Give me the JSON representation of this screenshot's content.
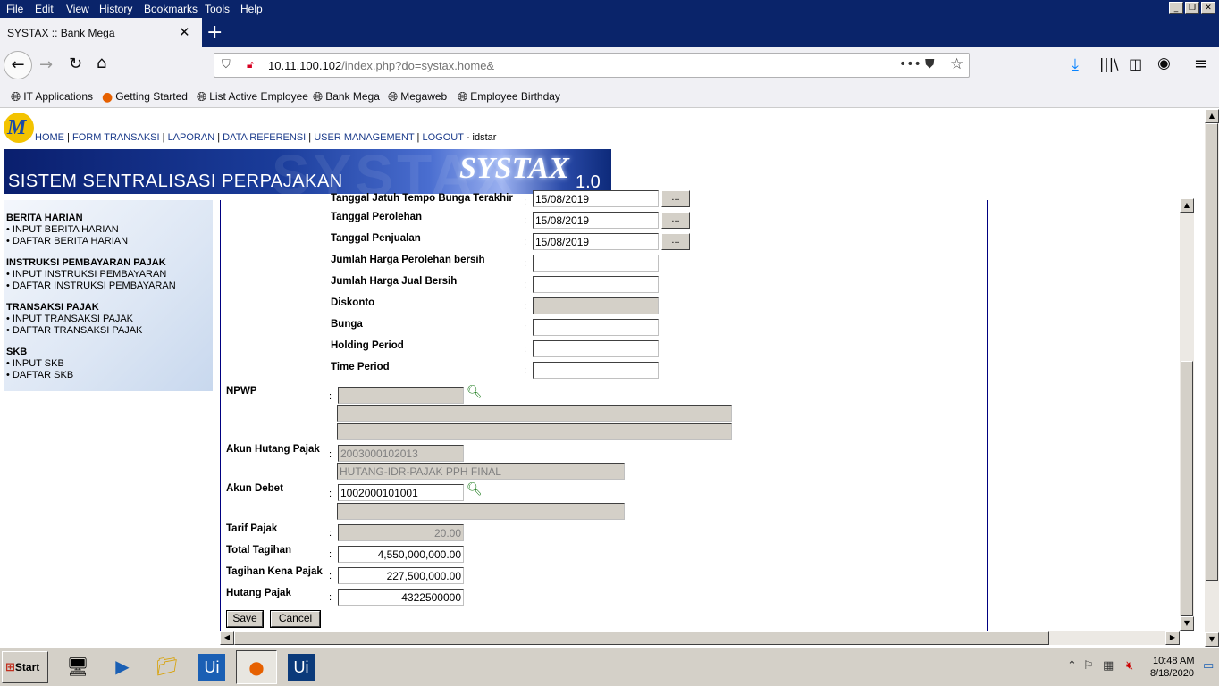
{
  "menubar": {
    "items": [
      "File",
      "Edit",
      "View",
      "History",
      "Bookmarks",
      "Tools",
      "Help"
    ]
  },
  "browser": {
    "tab_title": "SYSTAX :: Bank Mega",
    "url_host": "10.11.100.102",
    "url_path": "/index.php?do=systax.home&",
    "icons": {
      "back": "back-arrow-icon",
      "forward": "forward-arrow-icon",
      "reload": "reload-icon",
      "home": "home-icon",
      "download": "download-icon",
      "library": "library-icon",
      "sidebar": "sidebar-icon",
      "account": "account-icon",
      "menu": "hamburger-menu-icon"
    }
  },
  "bookmarks": [
    "IT Applications",
    "Getting Started",
    "List Active Employee",
    "Bank Mega",
    "Megaweb",
    "Employee Birthday"
  ],
  "site": {
    "topnav": [
      "HOME",
      "FORM TRANSAKSI",
      "LAPORAN",
      "DATA REFERENSI",
      "USER MANAGEMENT",
      "LOGOUT"
    ],
    "user_suffix": "- idstar",
    "banner_title": "SISTEM SENTRALISASI PERPAJAKAN",
    "banner_logo": "SYSTAX",
    "banner_version": "1.0",
    "banner_bg_text": "SYSTAX",
    "logo_letter": "M"
  },
  "sidebar": {
    "sections": [
      {
        "title": "BERITA HARIAN",
        "items": [
          "• INPUT BERITA HARIAN",
          "• DAFTAR BERITA HARIAN"
        ]
      },
      {
        "title": "INSTRUKSI PEMBAYARAN PAJAK",
        "items": [
          "• INPUT INSTRUKSI PEMBAYARAN",
          "• DAFTAR INSTRUKSI PEMBAYARAN"
        ]
      },
      {
        "title": "TRANSAKSI PAJAK",
        "items": [
          "• INPUT TRANSAKSI PAJAK",
          "• DAFTAR TRANSAKSI PAJAK"
        ]
      },
      {
        "title": "SKB",
        "items": [
          "• INPUT SKB",
          "• DAFTAR SKB"
        ]
      }
    ]
  },
  "form": {
    "colon": ":",
    "date_button": "...",
    "cut_label": "Tanggal Jatuh Tempo Bunga Terakhir",
    "cut_value": "15/08/2019",
    "tanggal_perolehan": {
      "label": "Tanggal Perolehan",
      "value": "15/08/2019"
    },
    "tanggal_penjualan": {
      "label": "Tanggal Penjualan",
      "value": "15/08/2019"
    },
    "jumlah_harga_perolehan": {
      "label": "Jumlah Harga Perolehan bersih",
      "value": ""
    },
    "jumlah_harga_jual": {
      "label": "Jumlah Harga Jual Bersih",
      "value": ""
    },
    "diskonto": {
      "label": "Diskonto",
      "value": ""
    },
    "bunga": {
      "label": "Bunga",
      "value": ""
    },
    "holding_period": {
      "label": "Holding Period",
      "value": ""
    },
    "time_period": {
      "label": "Time Period",
      "value": ""
    },
    "npwp": {
      "label": "NPWP",
      "value": "",
      "name1": "",
      "name2": ""
    },
    "akun_hutang_pajak": {
      "label": "Akun Hutang Pajak",
      "value": "2003000102013",
      "desc": "HUTANG-IDR-PAJAK PPH FINAL"
    },
    "akun_debet": {
      "label": "Akun Debet",
      "value": "1002000101001",
      "desc": ""
    },
    "tarif_pajak": {
      "label": "Tarif Pajak",
      "value": "20.00"
    },
    "total_tagihan": {
      "label": "Total Tagihan",
      "value": "4,550,000,000.00"
    },
    "tagihan_kena_pajak": {
      "label": "Tagihan Kena Pajak",
      "value": "227,500,000.00"
    },
    "hutang_pajak": {
      "label": "Hutang Pajak",
      "value": "4322500000"
    },
    "save_label": "Save",
    "cancel_label": "Cancel"
  },
  "taskbar": {
    "start_label": "Start",
    "apps": [
      "server-manager-icon",
      "powershell-icon",
      "file-explorer-icon",
      "uipath-studio-icon",
      "firefox-icon",
      "uipath-robot-icon"
    ],
    "ui_label": "Ui",
    "clock_time": "10:48 AM",
    "clock_date": "8/18/2020"
  }
}
